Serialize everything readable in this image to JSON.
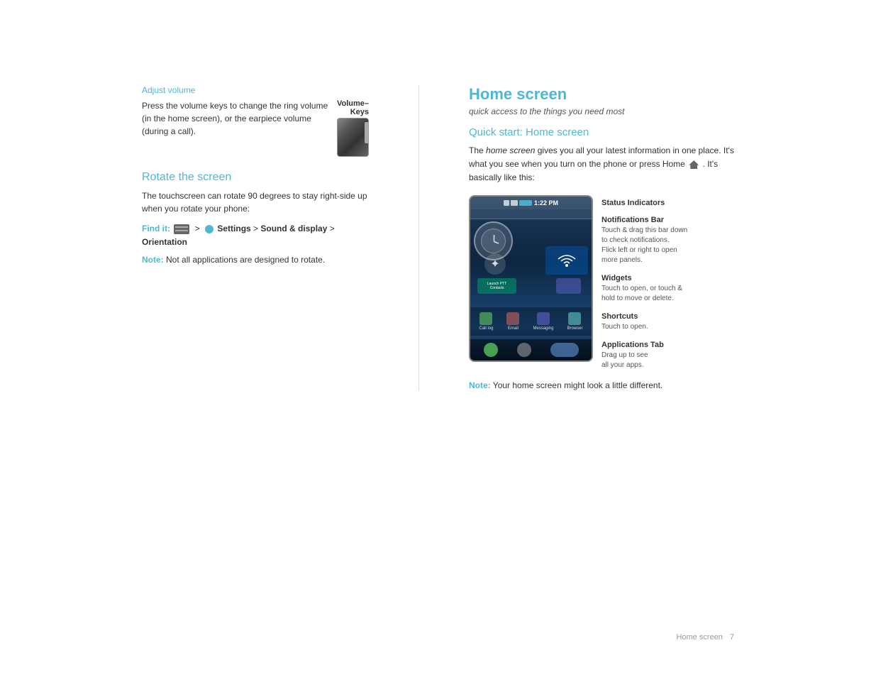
{
  "page": {
    "background": "#ffffff",
    "footer": {
      "page_label": "Home screen",
      "page_number": "7"
    }
  },
  "left_column": {
    "adjust_volume": {
      "section_title": "Adjust volume",
      "body": "Press the volume keys to change the ring volume (in the home screen), or the earpiece volume (during a call).",
      "volume_label": "Volume–\nKeys"
    },
    "rotate_screen": {
      "section_title": "Rotate the screen",
      "body": "The touchscreen can rotate 90 degrees to stay right-side up when you rotate your phone:",
      "find_it_label": "Find it:",
      "find_it_path": "Settings > Sound & display > Orientation",
      "note_label": "Note:",
      "note_text": "Not all applications are designed to rotate."
    }
  },
  "right_column": {
    "title": "Home screen",
    "subtitle": "quick access to the things you need most",
    "quick_start": {
      "title": "Quick start: Home screen",
      "body_part1": "The ",
      "body_italic": "home screen",
      "body_part2": " gives you all your latest information in one place. It's what you see when you turn on the phone or press Home",
      "body_part3": ". It's basically like this:"
    },
    "diagram": {
      "status_bar_label": "Status Indicators",
      "notifications_bar_label": "Notifications Bar",
      "notifications_bar_desc1": "Touch & drag this bar down",
      "notifications_bar_desc2": "to check notifications.",
      "notifications_bar_desc3": "Flick left or right to open",
      "notifications_bar_desc4": "more panels.",
      "widgets_label": "Widgets",
      "widgets_desc1": "Touch to open, or touch &",
      "widgets_desc2": "hold to move or delete.",
      "shortcuts_label": "Shortcuts",
      "shortcuts_desc": "Touch to open.",
      "apps_tab_label": "Applications Tab",
      "apps_tab_desc1": "Drag up to see",
      "apps_tab_desc2": "all your apps.",
      "phone_status_time": "1:22 PM",
      "shortcuts": [
        "Call log",
        "Email",
        "Messaging",
        "Browser"
      ]
    },
    "note_label": "Note:",
    "note_text": "Your home screen might look a little different."
  }
}
